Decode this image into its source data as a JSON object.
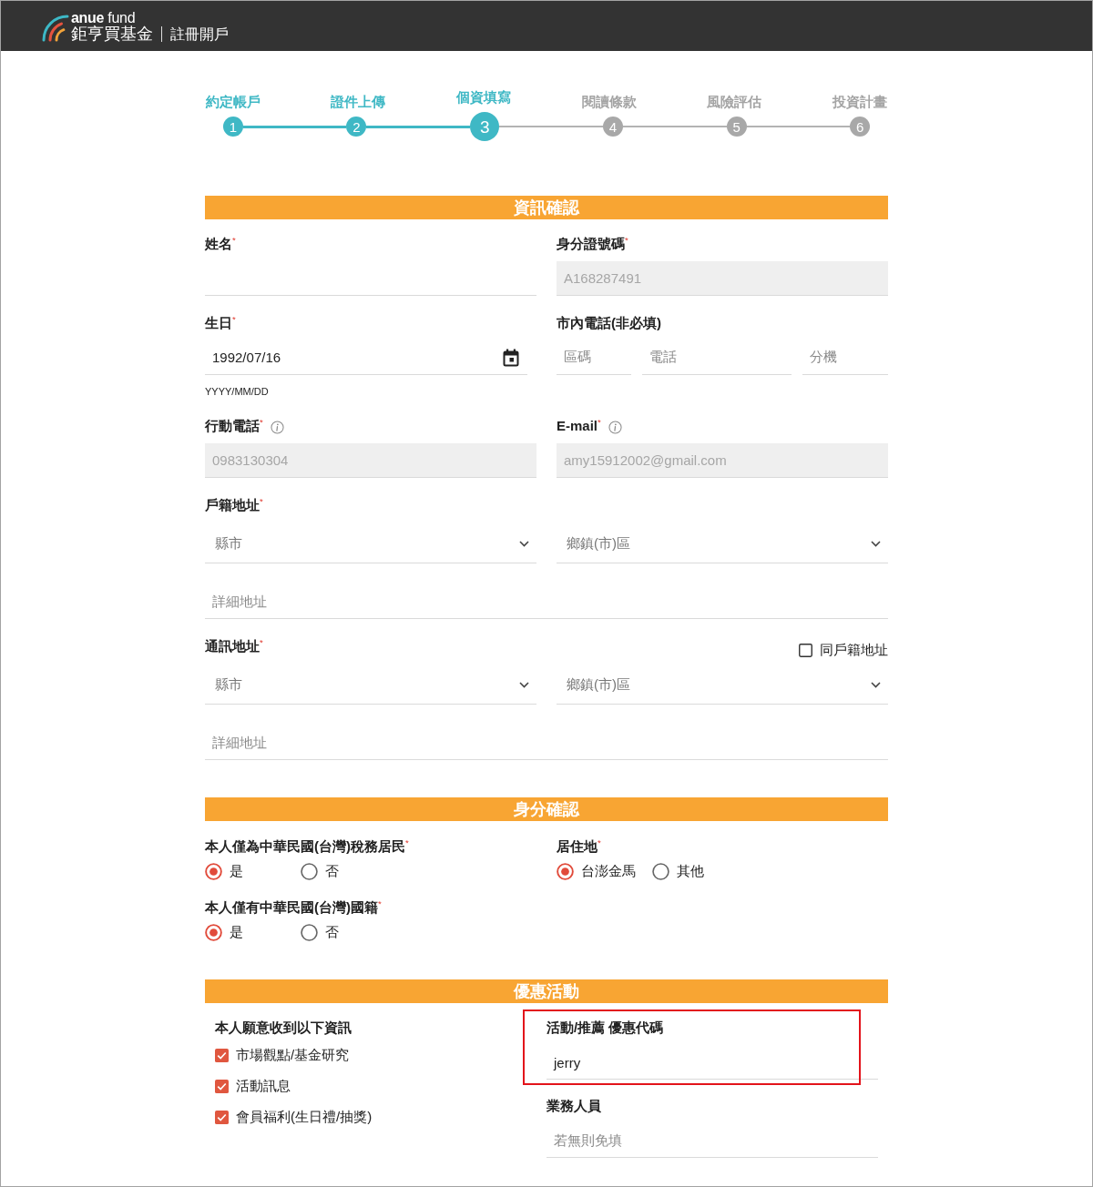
{
  "header": {
    "wordmark": "**anue** fund",
    "brand": "鉅亨買基金",
    "title": "註冊開戶"
  },
  "steps": [
    {
      "number": "1",
      "label": "約定帳戶",
      "completed": true,
      "selected": false
    },
    {
      "number": "2",
      "label": "證件上傳",
      "completed": true,
      "selected": false
    },
    {
      "number": "3",
      "label": "個資填寫",
      "completed": false,
      "selected": true
    },
    {
      "number": "4",
      "label": "閱讀條款",
      "completed": false,
      "selected": false
    },
    {
      "number": "5",
      "label": "風險評估",
      "completed": false,
      "selected": false
    },
    {
      "number": "6",
      "label": "投資計畫",
      "completed": false,
      "selected": false
    }
  ],
  "info": {
    "title": "資訊確認",
    "fields": [
      {
        "kind": "text",
        "label": "姓名$^{*}$",
        "disabled": false
      },
      {
        "kind": "text",
        "label": "身分證號碼$^{*}$",
        "value": "A168287491",
        "disabled": true
      },
      {
        "kind": "date",
        "label": "生日$^{*}$",
        "value": "1992/07/16",
        "hint": "YYYY/MM/DD"
      },
      {
        "kind": "phone",
        "label": "市內電話(非必填)",
        "parts": [
          {
            "placeholder": "區碼"
          },
          {
            "placeholder": "電話"
          },
          {
            "placeholder": "分機"
          }
        ]
      },
      {
        "kind": "text",
        "label": "行動電話$^{*}$",
        "info": true,
        "value": "0983130304",
        "disabled": true
      },
      {
        "kind": "text",
        "label": "E-mail$^{*}$",
        "info": true,
        "value": "amy15912002@gmail.com",
        "disabled": true
      }
    ],
    "addresses": [
      {
        "label": "戶籍地址$^{*}$",
        "city": {
          "placeholder": "縣市"
        },
        "district": {
          "placeholder": "鄉鎮(市)區"
        },
        "detail": {
          "placeholder": "詳細地址"
        }
      },
      {
        "label": "通訊地址$^{*}$",
        "same_as": {
          "label": "同戶籍地址",
          "checked": false
        },
        "city": {
          "placeholder": "縣市"
        },
        "district": {
          "placeholder": "鄉鎮(市)區"
        },
        "detail": {
          "placeholder": "詳細地址"
        }
      }
    ]
  },
  "identity": {
    "title": "身分確認",
    "questions": [
      {
        "label": "本人僅為中華民國(台灣)稅務居民$^{*}$",
        "options": [
          {
            "label": "是",
            "selected": true
          },
          {
            "label": "否",
            "selected": false
          }
        ]
      },
      {
        "label": "居住地$^{*}$",
        "options": [
          {
            "label": "台澎金馬",
            "selected": true
          },
          {
            "label": "其他",
            "selected": false
          }
        ]
      },
      {
        "label": "本人僅有中華民國(台灣)國籍$^{*}$",
        "options": [
          {
            "label": "是",
            "selected": true
          },
          {
            "label": "否",
            "selected": false
          }
        ]
      }
    ]
  },
  "promo": {
    "title": "優惠活動",
    "subscribe": {
      "label": "本人願意收到以下資訊",
      "options": [
        {
          "label": "市場觀點/基金研究",
          "checked": true
        },
        {
          "label": "活動訊息",
          "checked": true
        },
        {
          "label": "會員福利(生日禮/抽獎)",
          "checked": true
        }
      ]
    },
    "promo_code": {
      "label": "活動/推薦 優惠代碼",
      "value": "jerry",
      "highlighted": true
    },
    "sales_rep": {
      "label": "業務人員",
      "placeholder": "若無則免填"
    }
  }
}
